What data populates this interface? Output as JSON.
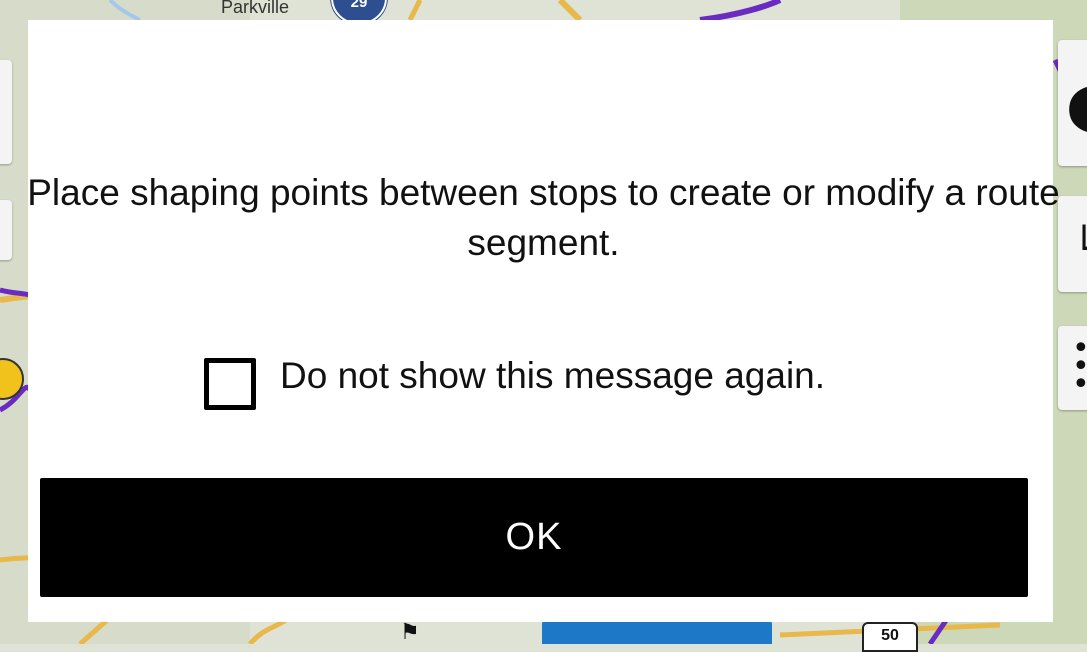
{
  "map": {
    "place_label": "Parkville",
    "interstate_shield": "29",
    "us_route_shield": "50",
    "colors": {
      "background": "#dfe3d6",
      "route_purple": "#6a2bc2",
      "road_yellow": "#e8b84a",
      "water_blue": "#a7c7ea"
    }
  },
  "dialog": {
    "message": "Place shaping points between stops to create or modify a route segment.",
    "checkbox_label": "Do not show this message again.",
    "checkbox_checked": false,
    "ok_label": "OK",
    "colors": {
      "dialog_background": "#ffffff",
      "button_background": "#000000",
      "button_text": "#ffffff"
    }
  }
}
